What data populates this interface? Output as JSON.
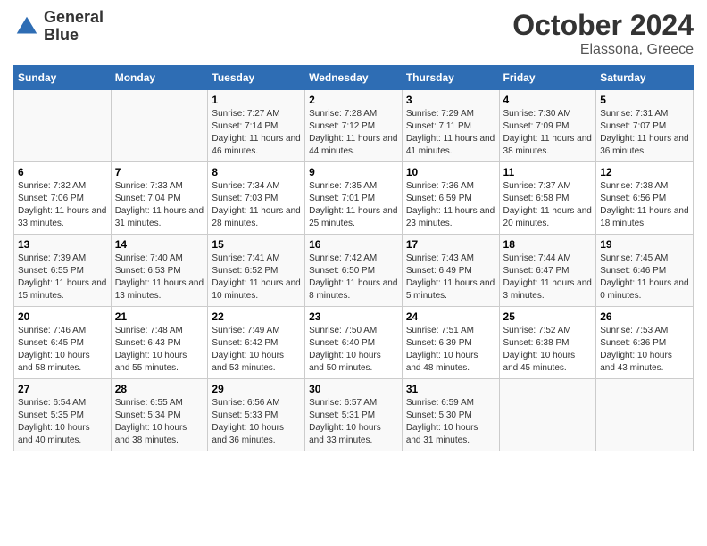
{
  "header": {
    "logo_line1": "General",
    "logo_line2": "Blue",
    "title": "October 2024",
    "subtitle": "Elassona, Greece"
  },
  "days_of_week": [
    "Sunday",
    "Monday",
    "Tuesday",
    "Wednesday",
    "Thursday",
    "Friday",
    "Saturday"
  ],
  "weeks": [
    [
      {
        "day": "",
        "sunrise": "",
        "sunset": "",
        "daylight": ""
      },
      {
        "day": "",
        "sunrise": "",
        "sunset": "",
        "daylight": ""
      },
      {
        "day": "1",
        "sunrise": "Sunrise: 7:27 AM",
        "sunset": "Sunset: 7:14 PM",
        "daylight": "Daylight: 11 hours and 46 minutes."
      },
      {
        "day": "2",
        "sunrise": "Sunrise: 7:28 AM",
        "sunset": "Sunset: 7:12 PM",
        "daylight": "Daylight: 11 hours and 44 minutes."
      },
      {
        "day": "3",
        "sunrise": "Sunrise: 7:29 AM",
        "sunset": "Sunset: 7:11 PM",
        "daylight": "Daylight: 11 hours and 41 minutes."
      },
      {
        "day": "4",
        "sunrise": "Sunrise: 7:30 AM",
        "sunset": "Sunset: 7:09 PM",
        "daylight": "Daylight: 11 hours and 38 minutes."
      },
      {
        "day": "5",
        "sunrise": "Sunrise: 7:31 AM",
        "sunset": "Sunset: 7:07 PM",
        "daylight": "Daylight: 11 hours and 36 minutes."
      }
    ],
    [
      {
        "day": "6",
        "sunrise": "Sunrise: 7:32 AM",
        "sunset": "Sunset: 7:06 PM",
        "daylight": "Daylight: 11 hours and 33 minutes."
      },
      {
        "day": "7",
        "sunrise": "Sunrise: 7:33 AM",
        "sunset": "Sunset: 7:04 PM",
        "daylight": "Daylight: 11 hours and 31 minutes."
      },
      {
        "day": "8",
        "sunrise": "Sunrise: 7:34 AM",
        "sunset": "Sunset: 7:03 PM",
        "daylight": "Daylight: 11 hours and 28 minutes."
      },
      {
        "day": "9",
        "sunrise": "Sunrise: 7:35 AM",
        "sunset": "Sunset: 7:01 PM",
        "daylight": "Daylight: 11 hours and 25 minutes."
      },
      {
        "day": "10",
        "sunrise": "Sunrise: 7:36 AM",
        "sunset": "Sunset: 6:59 PM",
        "daylight": "Daylight: 11 hours and 23 minutes."
      },
      {
        "day": "11",
        "sunrise": "Sunrise: 7:37 AM",
        "sunset": "Sunset: 6:58 PM",
        "daylight": "Daylight: 11 hours and 20 minutes."
      },
      {
        "day": "12",
        "sunrise": "Sunrise: 7:38 AM",
        "sunset": "Sunset: 6:56 PM",
        "daylight": "Daylight: 11 hours and 18 minutes."
      }
    ],
    [
      {
        "day": "13",
        "sunrise": "Sunrise: 7:39 AM",
        "sunset": "Sunset: 6:55 PM",
        "daylight": "Daylight: 11 hours and 15 minutes."
      },
      {
        "day": "14",
        "sunrise": "Sunrise: 7:40 AM",
        "sunset": "Sunset: 6:53 PM",
        "daylight": "Daylight: 11 hours and 13 minutes."
      },
      {
        "day": "15",
        "sunrise": "Sunrise: 7:41 AM",
        "sunset": "Sunset: 6:52 PM",
        "daylight": "Daylight: 11 hours and 10 minutes."
      },
      {
        "day": "16",
        "sunrise": "Sunrise: 7:42 AM",
        "sunset": "Sunset: 6:50 PM",
        "daylight": "Daylight: 11 hours and 8 minutes."
      },
      {
        "day": "17",
        "sunrise": "Sunrise: 7:43 AM",
        "sunset": "Sunset: 6:49 PM",
        "daylight": "Daylight: 11 hours and 5 minutes."
      },
      {
        "day": "18",
        "sunrise": "Sunrise: 7:44 AM",
        "sunset": "Sunset: 6:47 PM",
        "daylight": "Daylight: 11 hours and 3 minutes."
      },
      {
        "day": "19",
        "sunrise": "Sunrise: 7:45 AM",
        "sunset": "Sunset: 6:46 PM",
        "daylight": "Daylight: 11 hours and 0 minutes."
      }
    ],
    [
      {
        "day": "20",
        "sunrise": "Sunrise: 7:46 AM",
        "sunset": "Sunset: 6:45 PM",
        "daylight": "Daylight: 10 hours and 58 minutes."
      },
      {
        "day": "21",
        "sunrise": "Sunrise: 7:48 AM",
        "sunset": "Sunset: 6:43 PM",
        "daylight": "Daylight: 10 hours and 55 minutes."
      },
      {
        "day": "22",
        "sunrise": "Sunrise: 7:49 AM",
        "sunset": "Sunset: 6:42 PM",
        "daylight": "Daylight: 10 hours and 53 minutes."
      },
      {
        "day": "23",
        "sunrise": "Sunrise: 7:50 AM",
        "sunset": "Sunset: 6:40 PM",
        "daylight": "Daylight: 10 hours and 50 minutes."
      },
      {
        "day": "24",
        "sunrise": "Sunrise: 7:51 AM",
        "sunset": "Sunset: 6:39 PM",
        "daylight": "Daylight: 10 hours and 48 minutes."
      },
      {
        "day": "25",
        "sunrise": "Sunrise: 7:52 AM",
        "sunset": "Sunset: 6:38 PM",
        "daylight": "Daylight: 10 hours and 45 minutes."
      },
      {
        "day": "26",
        "sunrise": "Sunrise: 7:53 AM",
        "sunset": "Sunset: 6:36 PM",
        "daylight": "Daylight: 10 hours and 43 minutes."
      }
    ],
    [
      {
        "day": "27",
        "sunrise": "Sunrise: 6:54 AM",
        "sunset": "Sunset: 5:35 PM",
        "daylight": "Daylight: 10 hours and 40 minutes."
      },
      {
        "day": "28",
        "sunrise": "Sunrise: 6:55 AM",
        "sunset": "Sunset: 5:34 PM",
        "daylight": "Daylight: 10 hours and 38 minutes."
      },
      {
        "day": "29",
        "sunrise": "Sunrise: 6:56 AM",
        "sunset": "Sunset: 5:33 PM",
        "daylight": "Daylight: 10 hours and 36 minutes."
      },
      {
        "day": "30",
        "sunrise": "Sunrise: 6:57 AM",
        "sunset": "Sunset: 5:31 PM",
        "daylight": "Daylight: 10 hours and 33 minutes."
      },
      {
        "day": "31",
        "sunrise": "Sunrise: 6:59 AM",
        "sunset": "Sunset: 5:30 PM",
        "daylight": "Daylight: 10 hours and 31 minutes."
      },
      {
        "day": "",
        "sunrise": "",
        "sunset": "",
        "daylight": ""
      },
      {
        "day": "",
        "sunrise": "",
        "sunset": "",
        "daylight": ""
      }
    ]
  ]
}
